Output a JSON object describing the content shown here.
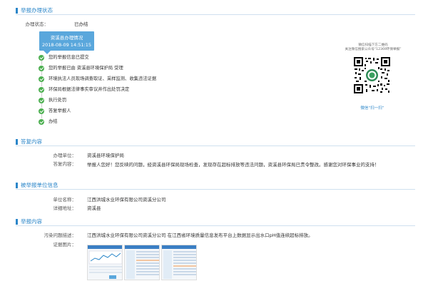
{
  "sections": {
    "status": "举报办理状态",
    "reply": "答复内容",
    "unit": "被举报单位信息",
    "report": "举报内容"
  },
  "status": {
    "label": "办理状态：",
    "value": "已办结",
    "box_title": "资溪县办理情况",
    "box_time": "2018-08-09 14:51:15"
  },
  "timeline": [
    "您的举报信息已提交",
    "您的举报已由 资溪县环境保护局 受理",
    "环境执法人员现场调查取证、采样监测、收集违法证据",
    "环保局根据法律事实审议并作出处罚决定",
    "执行处罚",
    "答复举报人",
    "办结"
  ],
  "qr": {
    "caption_line1": "微信扫描下方二维码",
    "caption_line2": "关注微信搜索公众号“12369环保举报”",
    "link": "微信“扫一扫”"
  },
  "reply": {
    "unit_label": "办理单位：",
    "unit_value": "资溪县环境保护局",
    "content_label": "答复内容：",
    "content_value": "举报人您好！您反映的问题，经资溪县环保局现场检查，发现存在超标排放等违法问题，资溪县环保局已责令整改。感谢您对环保事业的支持！"
  },
  "unit": {
    "name_label": "单位名称：",
    "name_value": "江西洪城水业环保有限公司资溪分公司",
    "address_label": "详细地址：",
    "address_value": "资溪县"
  },
  "report": {
    "desc_label": "污染问题描述：",
    "desc_value": "江西洪城水业环保有限公司资溪分公司 在江西省环境质量信息发布平台上数据显示出水口pH值连续超标排放。",
    "evidence_label": "证据图片："
  },
  "colors": {
    "accent": "#2b86c9",
    "status_box": "#5aa7dc",
    "check": "#4caf50"
  }
}
